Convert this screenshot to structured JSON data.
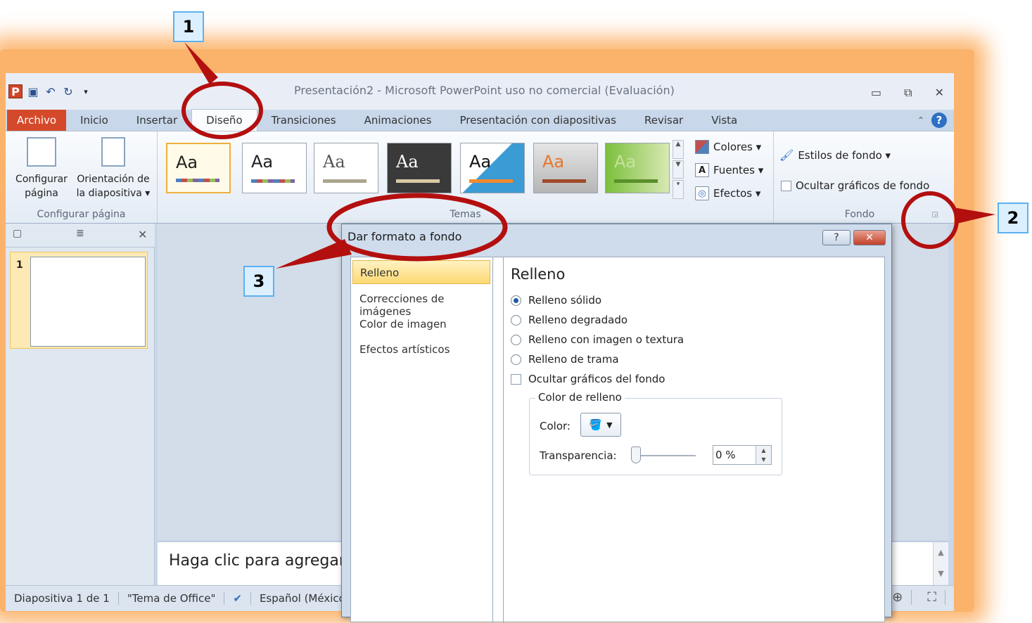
{
  "window": {
    "title": "Presentación2  -  Microsoft PowerPoint uso no comercial (Evaluación)",
    "qat_icons": [
      "powerpoint-logo",
      "save-icon",
      "undo-icon",
      "redo-icon",
      "customize-qat-icon"
    ],
    "buttons": [
      "minimize-icon",
      "restore-icon",
      "close-icon"
    ]
  },
  "tabs": [
    {
      "label": "Archivo"
    },
    {
      "label": "Inicio"
    },
    {
      "label": "Insertar"
    },
    {
      "label": "Diseño",
      "active": true
    },
    {
      "label": "Transiciones"
    },
    {
      "label": "Animaciones"
    },
    {
      "label": "Presentación con diapositivas"
    },
    {
      "label": "Revisar"
    },
    {
      "label": "Vista"
    }
  ],
  "ribbon": {
    "page_setup": {
      "configurar_l1": "Configurar",
      "configurar_l2": "página",
      "orientacion_l1": "Orientación de",
      "orientacion_l2": "la diapositiva ▾",
      "label": "Configurar página"
    },
    "themes": {
      "label": "Temas",
      "thumb_text": "Aa",
      "count": 7,
      "colores": "Colores ▾",
      "fuentes": "Fuentes ▾",
      "efectos": "Efectos ▾"
    },
    "background": {
      "estilos": "Estilos de fondo ▾",
      "ocultar": "Ocultar gráficos de fondo",
      "label": "Fondo"
    }
  },
  "slides": {
    "number": "1"
  },
  "notes": {
    "placeholder": "Haga clic para agregar notas"
  },
  "status": {
    "slide": "Diapositiva 1 de 1",
    "theme": "\"Tema de Office\"",
    "language": "Español (México)"
  },
  "dialog": {
    "title": "Dar formato a fondo",
    "help": "?",
    "close": "✕",
    "nav": [
      "Relleno",
      "Correcciones de imágenes",
      "Color de imagen",
      "Efectos artísticos"
    ],
    "section_title": "Relleno",
    "options": [
      "Relleno sólido",
      "Relleno degradado",
      "Relleno con imagen o textura",
      "Relleno de trama"
    ],
    "selected_option": "Relleno sólido",
    "hide_graphics": "Ocultar gráficos del fondo",
    "fill_group": "Color de relleno",
    "color_label": "Color:",
    "transparency_label": "Transparencia:",
    "transparency_value": "0 %"
  },
  "callouts": [
    "1",
    "2",
    "3"
  ]
}
